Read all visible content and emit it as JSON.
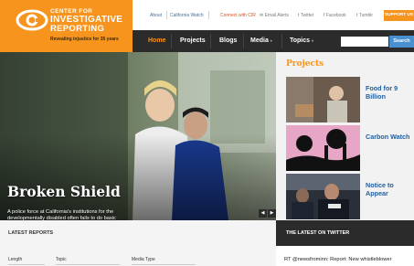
{
  "logo": {
    "line1": "CENTER FOR",
    "line2": "INVESTIGATIVE",
    "line3": "REPORTING",
    "tagline": "Revealing injustice for 35 years",
    "brand_color": "#f7941d"
  },
  "utility": {
    "about": "About",
    "california_watch": "California Watch",
    "connect": "Connect with CIR",
    "email": "Email Alerts",
    "twitter": "Twitter",
    "facebook": "Facebook",
    "tumblr": "Tumblr",
    "support": "SUPPORT US"
  },
  "nav": {
    "items": [
      {
        "label": "Home",
        "active": true
      },
      {
        "label": "Projects"
      },
      {
        "label": "Blogs"
      },
      {
        "label": "Media"
      },
      {
        "label": "Topics"
      }
    ],
    "search_button": "Search",
    "search_placeholder": ""
  },
  "hero": {
    "title": "Broken Shield",
    "description": "A police force at California's institutions for the developmentally disabled often fails to do basic investigative work, even when patients die under mysterious circumstances."
  },
  "projects": {
    "heading": "Projects",
    "items": [
      {
        "label": "Food for 9 Billion",
        "thumb_icon": "food-photo"
      },
      {
        "label": "Carbon Watch",
        "thumb_icon": "carbon-illustration"
      },
      {
        "label": "Notice to Appear",
        "thumb_icon": "police-photo"
      }
    ]
  },
  "latest_reports": {
    "heading": "LATEST REPORTS",
    "filters": [
      "Length",
      "Topic",
      "Media Type"
    ]
  },
  "twitter": {
    "heading": "THE LATEST ON TWITTER",
    "tweet": "RT @newsfrominn: Report: New whistleblower"
  },
  "colors": {
    "accent_orange": "#f7941d",
    "nav_dark": "#2b2b2b",
    "link_blue": "#1f5fa0"
  }
}
